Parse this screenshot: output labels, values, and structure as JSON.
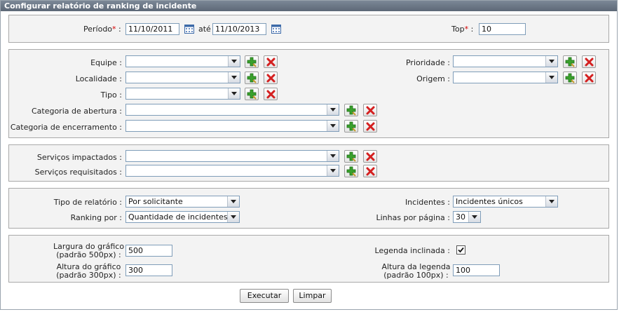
{
  "window": {
    "title": "Configurar relatório de ranking de incidente"
  },
  "period": {
    "label": "Período",
    "required_mark": "*",
    "separator_label": ":",
    "start": "11/10/2011",
    "between": "até",
    "end": "11/10/2013",
    "calendar_icon": "calendar-icon"
  },
  "top": {
    "label": "Top",
    "required_mark": "*",
    "separator": ":",
    "value": "10"
  },
  "filters": {
    "equipe": {
      "label": "Equipe :",
      "value": ""
    },
    "localidade": {
      "label": "Localidade :",
      "value": ""
    },
    "tipo": {
      "label": "Tipo :",
      "value": ""
    },
    "categoria_abertura": {
      "label": "Categoria de abertura :",
      "value": ""
    },
    "categoria_encerramento": {
      "label": "Categoria de encerramento :",
      "value": ""
    },
    "prioridade": {
      "label": "Prioridade :",
      "value": ""
    },
    "origem": {
      "label": "Origem :",
      "value": ""
    }
  },
  "services": {
    "impactados": {
      "label": "Serviços impactados :",
      "value": ""
    },
    "requisitados": {
      "label": "Serviços requisitados :",
      "value": ""
    }
  },
  "report": {
    "tipo_relatorio": {
      "label": "Tipo de relatório :",
      "value": "Por solicitante"
    },
    "ranking_por": {
      "label": "Ranking por :",
      "value": "Quantidade de incidentes"
    },
    "incidentes": {
      "label": "Incidentes :",
      "value": "Incidentes únicos"
    },
    "linhas_por_pagina": {
      "label": "Linhas por página :",
      "value": "30"
    }
  },
  "chart": {
    "largura": {
      "label_line1": "Largura do gráfico",
      "label_line2": "(padrão 500px) :",
      "value": "500"
    },
    "altura": {
      "label_line1": "Altura do gráfico",
      "label_line2": "(padrão 300px) :",
      "value": "300"
    },
    "legenda_inclinada": {
      "label": "Legenda inclinada :",
      "checked": true
    },
    "altura_legenda": {
      "label_line1": "Altura da legenda",
      "label_line2": "(padrão 100px) :",
      "value": "100"
    }
  },
  "actions": {
    "execute": "Executar",
    "clear": "Limpar"
  },
  "icons": {
    "add": "add-filter-icon",
    "remove": "remove-filter-icon"
  }
}
